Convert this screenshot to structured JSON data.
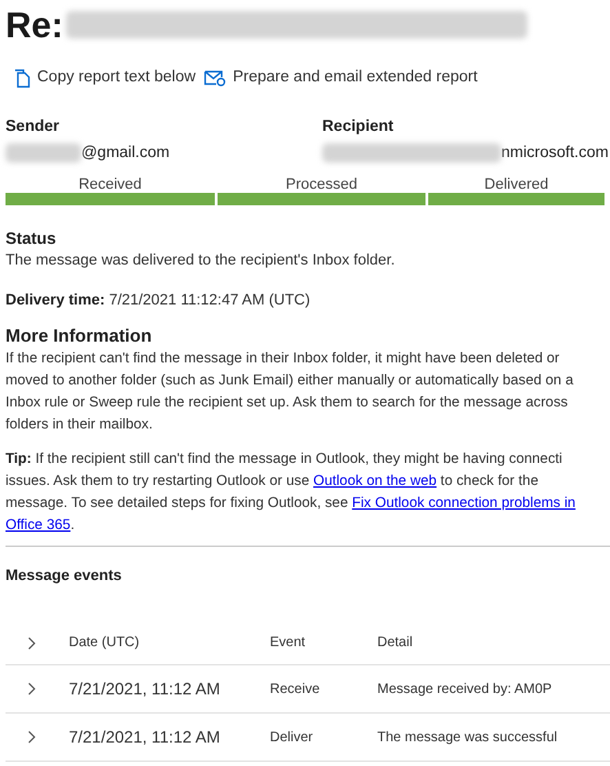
{
  "title": {
    "prefix": "Re:"
  },
  "actions": [
    {
      "kind": "copy",
      "label": "Copy report text below"
    },
    {
      "kind": "email",
      "label": "Prepare and email extended report"
    }
  ],
  "parties": [
    {
      "label": "Sender",
      "value": "@gmail.com"
    },
    {
      "label": "Recipient",
      "value": "nmicrosoft.com"
    }
  ],
  "stages": [
    {
      "label": "Received",
      "done": true
    },
    {
      "label": "Processed",
      "done": true
    },
    {
      "label": "Delivered",
      "done": true
    }
  ],
  "status": {
    "heading": "Status",
    "text": "The message was delivered to the recipient's Inbox folder.",
    "delivery_label": "Delivery time:",
    "delivery_value": "7/21/2021 11:12:47 AM (UTC)"
  },
  "more_info": {
    "heading": "More Information",
    "lines": [
      "If the recipient can't find the message in their Inbox folder, it might have been deleted or",
      "moved to another folder (such as Junk Email) either manually or automatically based on a",
      "Inbox rule or Sweep rule the recipient set up. Ask them to search for the message across",
      "folders in their mailbox."
    ]
  },
  "tip": {
    "lines": [
      [
        {
          "kind": "bold",
          "text": "Tip:"
        },
        {
          "kind": "text",
          "text": " If the recipient still can't find the message in Outlook, they might be having connecti"
        }
      ],
      [
        {
          "kind": "text",
          "text": "issues. Ask them to try restarting Outlook or use "
        },
        {
          "kind": "link",
          "text": "Outlook on the web"
        },
        {
          "kind": "text",
          "text": " to check for the"
        }
      ],
      [
        {
          "kind": "text",
          "text": "message. To see detailed steps for fixing Outlook, see "
        },
        {
          "kind": "link",
          "text": "Fix Outlook connection problems in"
        }
      ],
      [
        {
          "kind": "link",
          "text": "Office 365"
        },
        {
          "kind": "text",
          "text": "."
        }
      ]
    ]
  },
  "events": {
    "heading": "Message events",
    "columns": [
      "Date (UTC)",
      "Event",
      "Detail"
    ],
    "rows": [
      [
        "7/21/2021, 11:12 AM",
        "Receive",
        "Message received by: AM0P"
      ],
      [
        "7/21/2021, 11:12 AM",
        "Deliver",
        "The message was successful"
      ]
    ]
  }
}
